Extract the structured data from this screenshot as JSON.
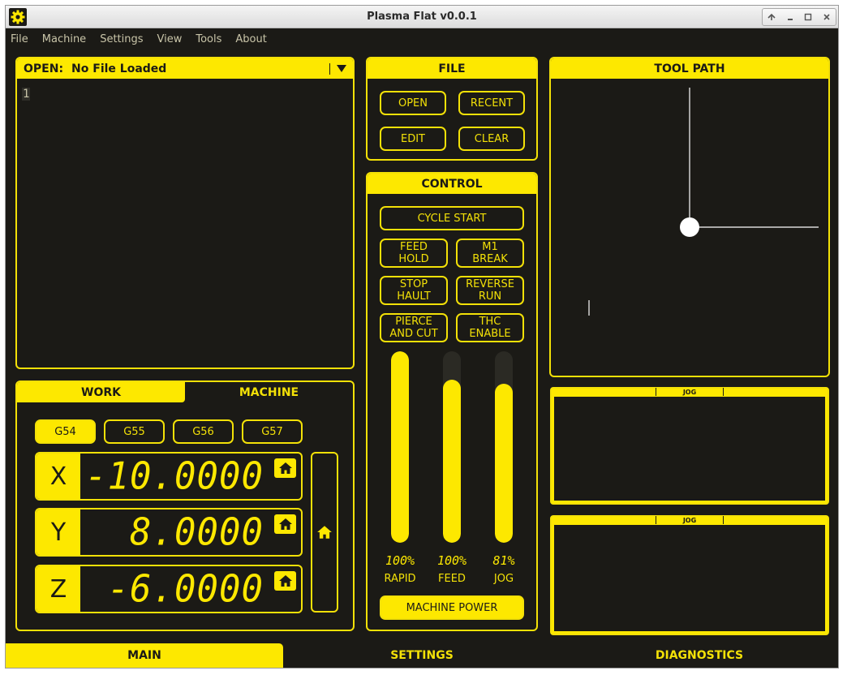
{
  "window": {
    "title": "Plasma Flat v0.0.1"
  },
  "menu": [
    "File",
    "Machine",
    "Settings",
    "View",
    "Tools",
    "About"
  ],
  "gcode": {
    "open_label": "OPEN:",
    "file_name": "No File Loaded",
    "line_number": "1"
  },
  "file_panel": {
    "title": "FILE",
    "buttons": [
      "OPEN",
      "RECENT",
      "EDIT",
      "CLEAR"
    ]
  },
  "control_panel": {
    "title": "CONTROL",
    "cycle_start": "CYCLE START",
    "buttons": [
      "FEED\nHOLD",
      "M1\nBREAK",
      "STOP\nHAULT",
      "REVERSE\nRUN",
      "PIERCE\nAND CUT",
      "THC\nENABLE"
    ],
    "overrides": [
      {
        "label": "RAPID",
        "readout": "100%",
        "fraction": 1.0
      },
      {
        "label": "FEED",
        "readout": "100%",
        "fraction": 0.85
      },
      {
        "label": "JOG",
        "readout": "81%",
        "fraction": 0.83
      }
    ],
    "machine_power": "MACHINE POWER"
  },
  "tool_path": {
    "title": "TOOL PATH"
  },
  "dro": {
    "tabs": [
      "WORK",
      "MACHINE"
    ],
    "active_tab": "WORK",
    "work_offsets": [
      "G54",
      "G55",
      "G56",
      "G57"
    ],
    "active_offset": "G54",
    "axes": [
      {
        "label": "X",
        "value": "-10.0000"
      },
      {
        "label": "Y",
        "value": "8.0000"
      },
      {
        "label": "Z",
        "value": "-6.0000"
      }
    ]
  },
  "jog_panels": [
    {
      "title": "JOG"
    },
    {
      "title": "JOG"
    }
  ],
  "bottom_tabs": [
    "MAIN",
    "SETTINGS",
    "DIAGNOSTICS"
  ],
  "active_bottom_tab": "MAIN",
  "colors": {
    "accent": "#fde800",
    "background": "#1b1a16",
    "muted_text": "#c8c4a8"
  }
}
